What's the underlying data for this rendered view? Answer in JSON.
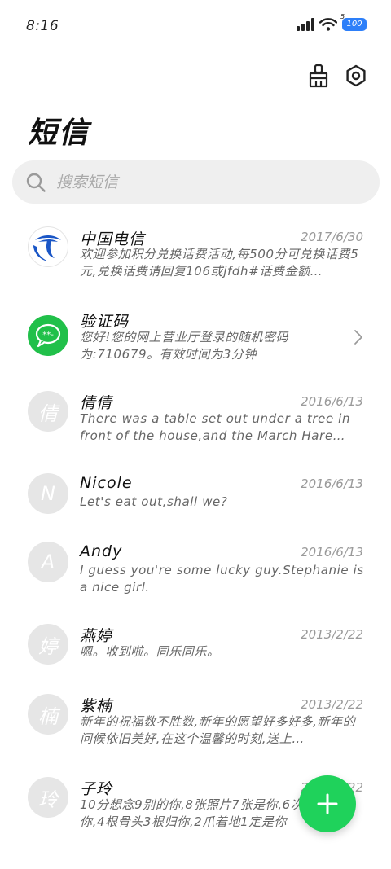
{
  "status": {
    "time": "8:16",
    "battery": "100",
    "battery_top": "5"
  },
  "header": {
    "title": "短信"
  },
  "search": {
    "placeholder": "搜索短信"
  },
  "messages": [
    {
      "sender": "中国电信",
      "date": "2017/6/30",
      "preview": "欢迎参加积分兑换话费活动,每500分可兑换话费5元,兑换话费请回复106或jfdh#话费金额…",
      "avatar_type": "logo"
    },
    {
      "sender": "验证码",
      "date": "",
      "preview": "您好!您的网上营业厅登录的随机密码为:710679。有效时间为3分钟",
      "avatar_type": "sms"
    },
    {
      "sender": "倩倩",
      "date": "2016/6/13",
      "preview": "There was a table set out under a tree in front of the house,and the March Hare and…",
      "avatar": "倩"
    },
    {
      "sender": "Nicole",
      "date": "2016/6/13",
      "preview": "Let's eat out,shall we?",
      "avatar": "N"
    },
    {
      "sender": "Andy",
      "date": "2016/6/13",
      "preview": "I guess you're some lucky guy.Stephanie is a nice girl.",
      "avatar": "A"
    },
    {
      "sender": "燕婷",
      "date": "2013/2/22",
      "preview": "嗯。收到啦。同乐同乐。",
      "avatar": "婷"
    },
    {
      "sender": "紫楠",
      "date": "2013/2/22",
      "preview": "新年的祝福数不胜数,新年的愿望好多好多,新年的问候依旧美好,在这个温馨的时刻,送上…",
      "avatar": "楠"
    },
    {
      "sender": "子玲",
      "date": "2013/2/22",
      "preview": "10分想念9别的你,8张照片7张是你,6次梦里只像你,4根骨头3根归你,2爪着地1定是你",
      "avatar": "玲"
    }
  ],
  "colors": {
    "accent_green": "#1fd25b",
    "telecom_blue": "#1a56c6",
    "sms_green": "#21c04a"
  }
}
